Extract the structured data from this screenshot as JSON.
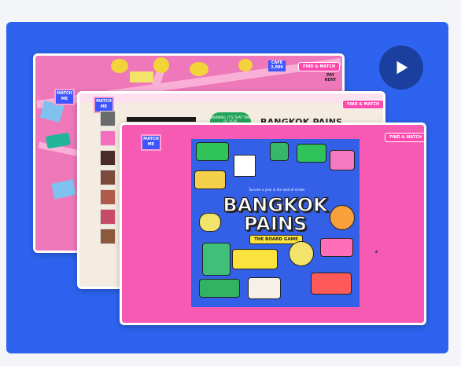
{
  "player": {
    "play_label": "Play video"
  },
  "slides": {
    "back": {
      "tag_text": "MATCH ME",
      "pill_text": "FIND & MATCH",
      "sign_1": "CAFE 2,000",
      "sign_2": "PAY RENT"
    },
    "mid": {
      "tag_text": "MATCH ME",
      "pill_text": "FIND & MATCH",
      "badge_text": "WARNING: IT'S THAT TIME OF YEAR",
      "title": "BANGKOK PAINS"
    },
    "front": {
      "tag_text": "MATCH ME",
      "pill_text": "FIND & MATCH",
      "poster": {
        "tagline": "Survive a year in the land of smiles",
        "title_line1": "BANGKOK",
        "title_line2": "PAINS",
        "subtitle": "THE BOARD GAME"
      }
    }
  },
  "colors": {
    "stage": "#2d63ee",
    "play_button": "#1b3f9f",
    "front_card": "#f75ab3",
    "poster_bg": "#3460e8"
  }
}
